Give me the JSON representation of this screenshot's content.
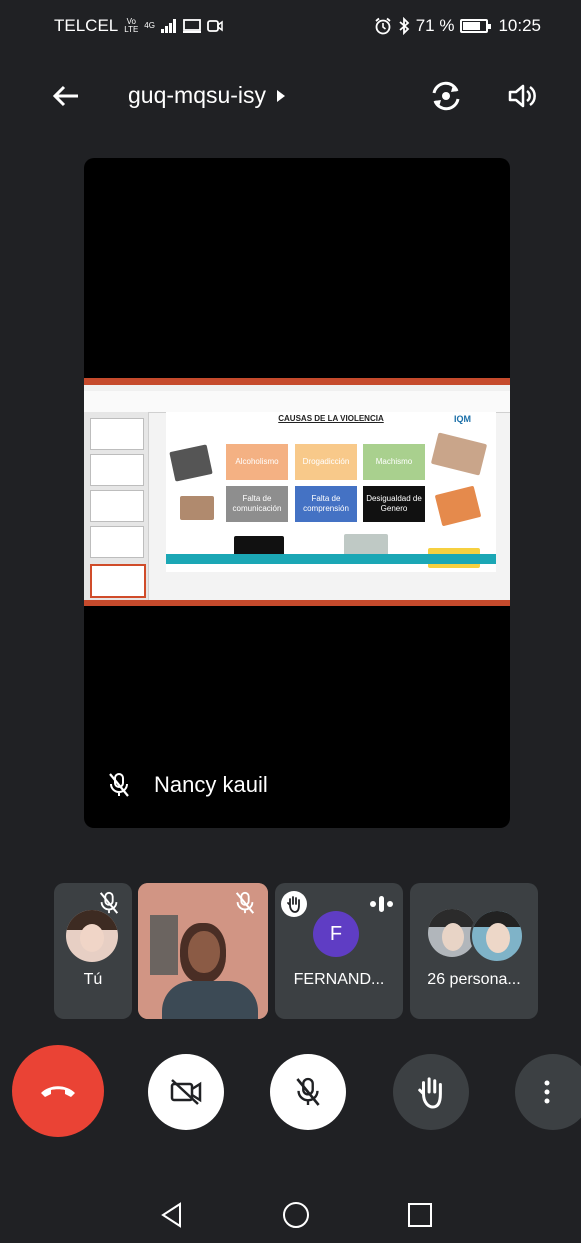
{
  "status_bar": {
    "carrier": "TELCEL",
    "network_type": "4G",
    "volte": "Vo LTE",
    "battery": "71 %",
    "battery_level": 0.71,
    "time": "10:25"
  },
  "header": {
    "meeting_code": "guq-mqsu-isy"
  },
  "main_tile": {
    "speaker_name": "Nancy kauil",
    "slide": {
      "title": "CAUSAS DE LA VIOLENCIA",
      "logo_text": "IQM",
      "causes": [
        {
          "label": "Alcoholismo",
          "color": "#f4b183"
        },
        {
          "label": "Drogadicción",
          "color": "#f8c98a"
        },
        {
          "label": "Machismo",
          "color": "#a9d08e"
        },
        {
          "label": "Falta de comunicación",
          "color": "#8e8e8e"
        },
        {
          "label": "Falta de comprensión",
          "color": "#4472c4"
        },
        {
          "label": "Desigualdad de Genero",
          "color": "#111111"
        }
      ]
    }
  },
  "participants": [
    {
      "label": "Tú"
    },
    {
      "label": ""
    },
    {
      "label": "FERNAND...",
      "initial": "F",
      "avatar_color": "#5f3dc4"
    },
    {
      "label": "26 persona..."
    }
  ],
  "colors": {
    "background": "#202124",
    "tile": "#3c4043",
    "end_call": "#ea4335"
  }
}
